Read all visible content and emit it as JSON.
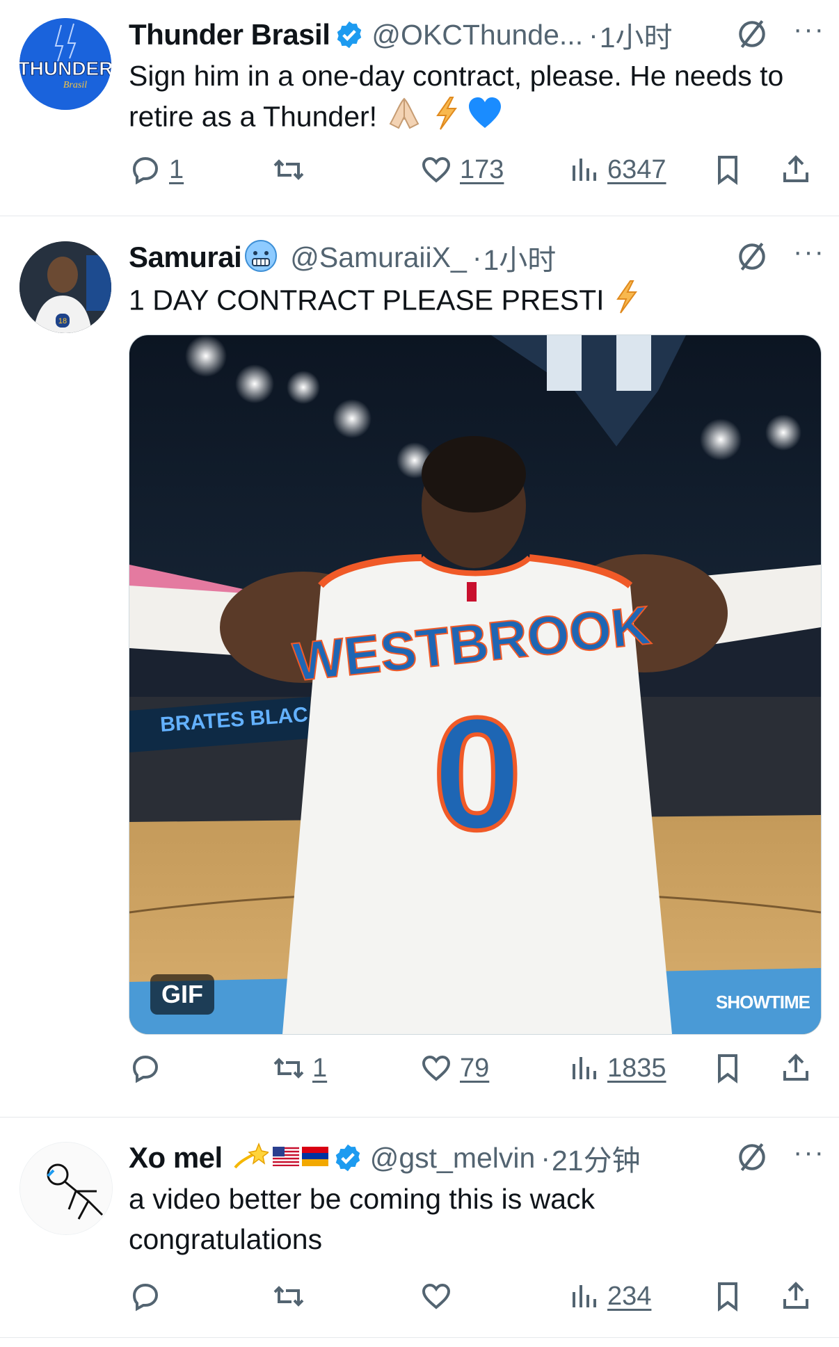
{
  "tweets": [
    {
      "name": "Thunder Brasil",
      "handle": "@OKCThunde...",
      "time": "1小时",
      "text": "Sign him in a one-day contract, please. He needs to retire as a Thunder!",
      "avatar_text": "THUNDER",
      "actions": {
        "replies": "1",
        "reposts": "",
        "likes": "173",
        "views": "6347"
      }
    },
    {
      "name": "Samurai",
      "handle": "@SamuraiiX_",
      "time": "1小时",
      "text": "1 DAY CONTRACT PLEASE PRESTI",
      "media": {
        "badge": "GIF",
        "watermark": "SHOWTIME",
        "jersey_name": "WESTBROOK",
        "jersey_number": "0",
        "banner_text": "BRATES BLAC"
      },
      "actions": {
        "replies": "",
        "reposts": "1",
        "likes": "79",
        "views": "1835"
      }
    },
    {
      "name": "Xo mel",
      "handle": "@gst_melvin",
      "time": "21分钟",
      "text": "a video better be coming this is wack congratulations",
      "actions": {
        "replies": "",
        "reposts": "",
        "likes": "",
        "views": "234"
      }
    }
  ],
  "colors": {
    "verified": "#1d9bf0",
    "muted": "#536471",
    "thunder_blue": "#0d64e8",
    "lightning": "#f8b84e"
  }
}
